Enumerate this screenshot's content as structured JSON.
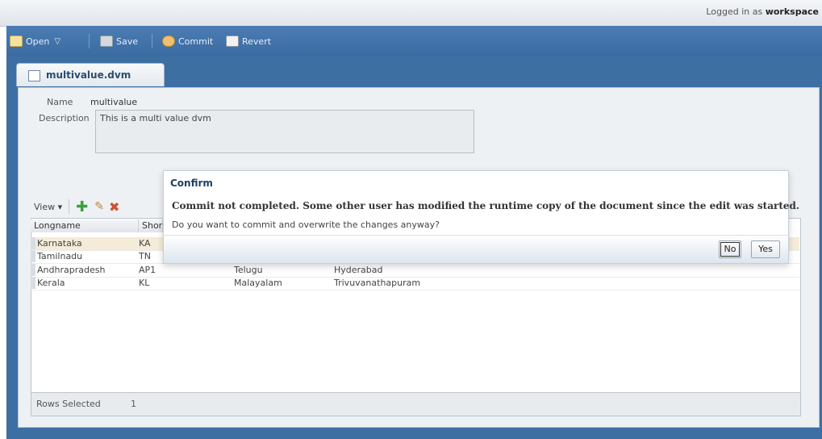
{
  "header": {
    "login_prefix": "Logged in as ",
    "login_user": "workspace"
  },
  "toolbar": {
    "open_label": "Open",
    "save_label": "Save",
    "commit_label": "Commit",
    "revert_label": "Revert"
  },
  "tab": {
    "label": "multivalue.dvm"
  },
  "form": {
    "name_label": "Name",
    "name_value": "multivalue",
    "description_label": "Description",
    "description_value": "This is a multi value dvm"
  },
  "table_toolbar": {
    "view_label": "View ▾"
  },
  "table": {
    "columns": [
      "Longname",
      "Shor"
    ],
    "rows": [
      [
        "Karnataka",
        "KA",
        "",
        ""
      ],
      [
        "Tamilnadu",
        "TN",
        "",
        ""
      ],
      [
        "Andhrapradesh",
        "AP1",
        "Telugu",
        "Hyderabad"
      ],
      [
        "Kerala",
        "KL",
        "Malayalam",
        "Trivuvanathapuram"
      ]
    ],
    "selected_row": 0
  },
  "status": {
    "rows_selected_label": "Rows Selected",
    "rows_selected_value": "1"
  },
  "dialog": {
    "title": "Confirm",
    "message": "Commit not completed. Some other user has modified the runtime copy of the document since the edit was started.",
    "question": "Do you want to commit and overwrite the changes anyway?",
    "no_label": "No",
    "yes_label": "Yes"
  },
  "colors": {
    "frame_blue": "#3e6fa3",
    "selected_row": "#f4ecd8",
    "dialog_title": "#1f3f65"
  }
}
